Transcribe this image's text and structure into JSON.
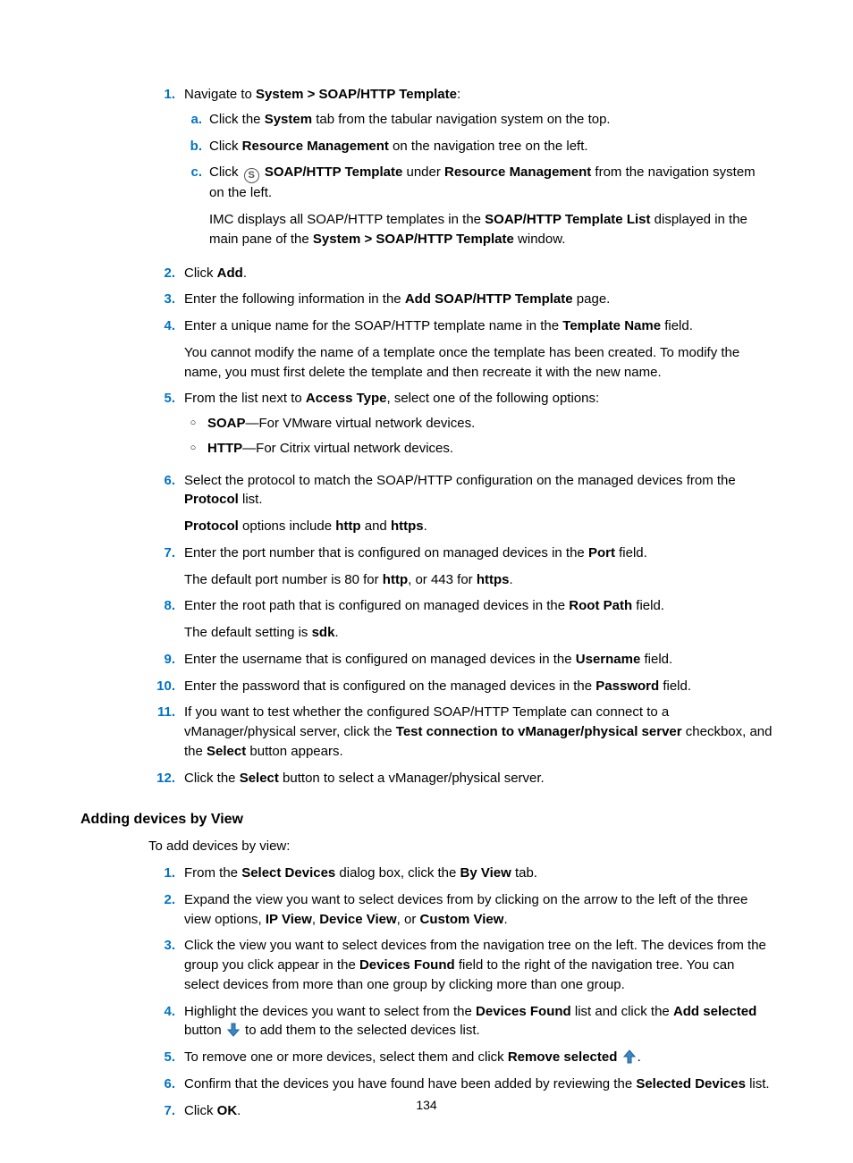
{
  "page_number": "134",
  "section1": {
    "items": [
      {
        "num": "1.",
        "text_pre": "Navigate to ",
        "b1": "System > SOAP/HTTP Template",
        "text_post": ":",
        "sub": [
          {
            "num": "a.",
            "parts": [
              "Click the ",
              "System",
              " tab from the tabular navigation system on the top."
            ]
          },
          {
            "num": "b.",
            "parts": [
              "Click ",
              "Resource Management",
              " on the navigation tree on the left."
            ]
          },
          {
            "num": "c.",
            "pre": "Click ",
            "icon": "S",
            "b1": "SOAP/HTTP Template",
            "mid": " under ",
            "b2": "Resource Management",
            "post": " from the navigation system on the left."
          },
          {
            "num": "",
            "plain_pre": "IMC displays all SOAP/HTTP templates in the ",
            "b1": "SOAP/HTTP Template List",
            "mid": " displayed in the main pane of the ",
            "b2": "System > SOAP/HTTP Template",
            "post": " window."
          }
        ]
      },
      {
        "num": "2.",
        "parts": [
          "Click ",
          "Add",
          "."
        ]
      },
      {
        "num": "3.",
        "parts": [
          "Enter the following information in the ",
          "Add SOAP/HTTP Template",
          " page."
        ]
      },
      {
        "num": "4.",
        "parts": [
          "Enter a unique name for the SOAP/HTTP template name in the ",
          "Template Name",
          " field."
        ],
        "after": "You cannot modify the name of a template once the template has been created. To modify the name, you must first delete the template and then recreate it with the new name."
      },
      {
        "num": "5.",
        "parts": [
          "From the list next to ",
          "Access Type",
          ", select one of the following options:"
        ],
        "bullets": [
          {
            "b": "SOAP",
            "t": "—For VMware virtual network devices."
          },
          {
            "b": "HTTP",
            "t": "—For Citrix virtual network devices."
          }
        ]
      },
      {
        "num": "6.",
        "parts": [
          "Select the protocol to match the SOAP/HTTP configuration on the managed devices from the ",
          "Protocol",
          " list."
        ],
        "after_rich": {
          "b1": "Protocol",
          "t1": " options include ",
          "b2": "http",
          "t2": " and ",
          "b3": "https",
          "t3": "."
        }
      },
      {
        "num": "7.",
        "parts": [
          "Enter the port number that is configured on managed devices in the ",
          "Port",
          " field."
        ],
        "after_rich": {
          "t0": "The default port number is 80 for ",
          "b1": "http",
          "t1": ", or 443 for ",
          "b2": "https",
          "t2": "."
        }
      },
      {
        "num": "8.",
        "parts": [
          "Enter the root path that is configured on managed devices in the ",
          "Root Path",
          " field."
        ],
        "after_rich": {
          "t0": "The default setting is ",
          "b1": "sdk",
          "t1": "."
        }
      },
      {
        "num": "9.",
        "parts": [
          "Enter the username that is configured on managed devices in the ",
          "Username",
          " field."
        ]
      },
      {
        "num": "10.",
        "parts": [
          "Enter the password that is configured on the managed devices in the ",
          "Password",
          " field."
        ]
      },
      {
        "num": "11.",
        "parts_ext": {
          "t0": "If you want to test whether the configured SOAP/HTTP Template can connect to a vManager/physical server, click the ",
          "b1": "Test connection to vManager/physical server",
          "t1": " checkbox, and the ",
          "b2": "Select",
          "t2": " button appears."
        }
      },
      {
        "num": "12.",
        "parts": [
          "Click the ",
          "Select",
          " button to select a vManager/physical server."
        ]
      }
    ]
  },
  "section2": {
    "heading": "Adding devices by View",
    "intro": "To add devices by view:",
    "items": [
      {
        "num": "1.",
        "parts_ext": {
          "t0": "From the ",
          "b1": "Select Devices",
          "t1": " dialog box, click the ",
          "b2": "By View",
          "t2": " tab."
        }
      },
      {
        "num": "2.",
        "parts_ext": {
          "t0": "Expand the view you want to select devices from by clicking on the arrow to the left of the three view options, ",
          "b1": "IP View",
          "t1": ", ",
          "b2": "Device View",
          "t2": ", or ",
          "b3": "Custom View",
          "t3": "."
        }
      },
      {
        "num": "3.",
        "parts_ext": {
          "t0": "Click the view you want to select devices from the navigation tree on the left. The devices from the group you click appear in the ",
          "b1": "Devices Found",
          "t1": " field to the right of the navigation tree. You can select devices from more than one group by clicking more than one group."
        }
      },
      {
        "num": "4.",
        "parts_ext": {
          "t0": "Highlight the devices you want to select from the ",
          "b1": "Devices Found",
          "t1": " list and click the ",
          "b2": "Add selected",
          "t2": " button "
        },
        "icon": "arrow-down",
        "after_icon": " to add them to the selected devices list."
      },
      {
        "num": "5.",
        "parts_ext": {
          "t0": "To remove one or more devices, select them and click ",
          "b1": "Remove selected "
        },
        "icon": "arrow-up",
        "after_icon": "."
      },
      {
        "num": "6.",
        "parts_ext": {
          "t0": "Confirm that the devices you have found have been added by reviewing the ",
          "b1": "Selected Devices",
          "t1": " list."
        }
      },
      {
        "num": "7.",
        "parts": [
          "Click ",
          "OK",
          "."
        ]
      }
    ]
  }
}
